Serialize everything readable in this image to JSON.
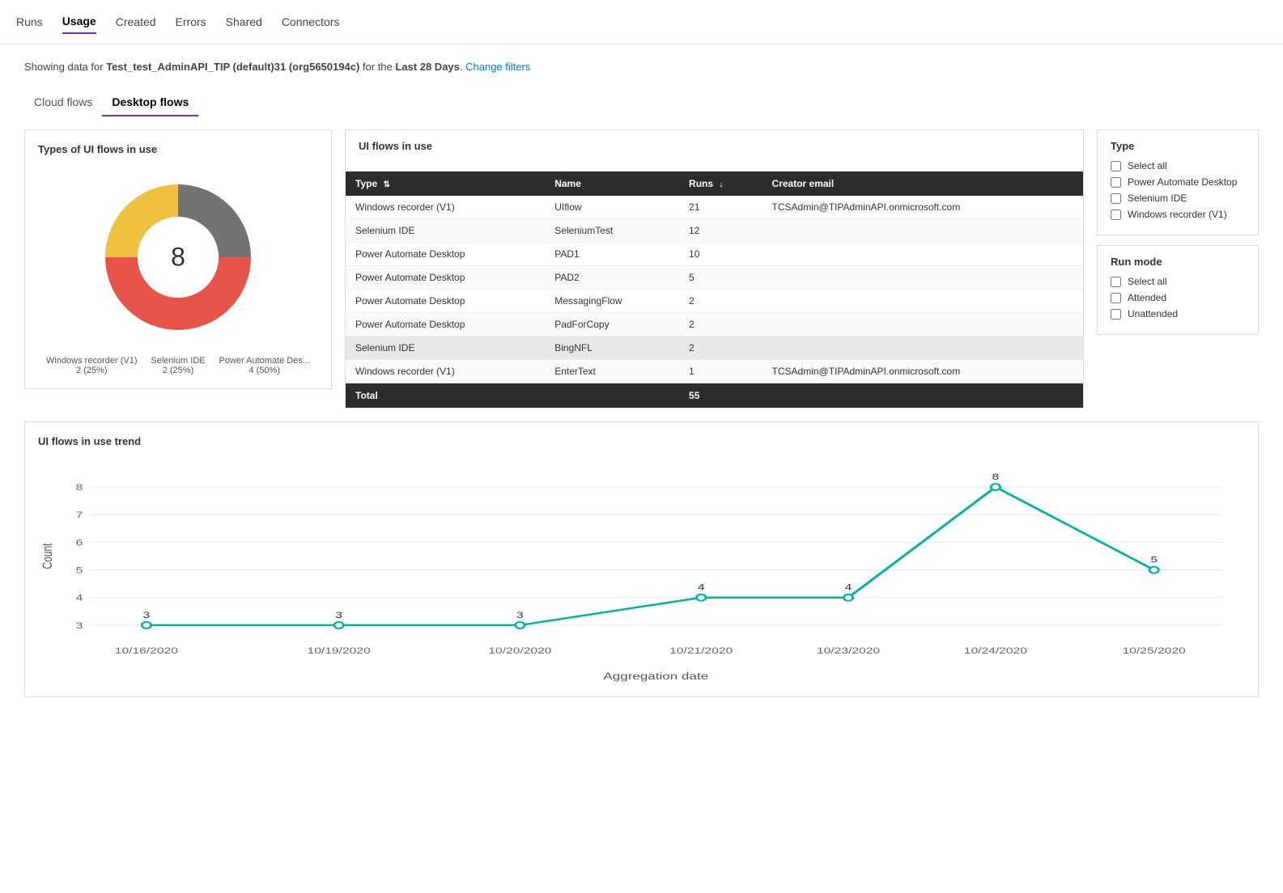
{
  "nav": {
    "items": [
      {
        "label": "Runs",
        "active": false
      },
      {
        "label": "Usage",
        "active": true
      },
      {
        "label": "Created",
        "active": false
      },
      {
        "label": "Errors",
        "active": false
      },
      {
        "label": "Shared",
        "active": false
      },
      {
        "label": "Connectors",
        "active": false
      }
    ]
  },
  "subtitle": {
    "prefix": "Showing data for",
    "org": "Test_test_AdminAPI_TIP (default)31 (org5650194c)",
    "mid": "for the",
    "period": "Last 28 Days",
    "link": "Change filters"
  },
  "flow_tabs": [
    {
      "label": "Cloud flows",
      "active": false
    },
    {
      "label": "Desktop flows",
      "active": true
    }
  ],
  "donut": {
    "title": "Types of UI flows in use",
    "center_value": "8",
    "segments": [
      {
        "label": "Windows recorder (V1)",
        "short": "Windows recorder (V1)",
        "value": "2 (25%)",
        "color": "#737373",
        "percent": 25
      },
      {
        "label": "Power Automate Des...",
        "short": "Power Automate Des...",
        "value": "4 (50%)",
        "color": "#e8534a",
        "percent": 50
      },
      {
        "label": "Selenium IDE",
        "short": "Selenium IDE",
        "value": "2 (25%)",
        "color": "#f0c040",
        "percent": 25
      }
    ]
  },
  "table": {
    "title": "UI flows in use",
    "columns": [
      "Type",
      "Name",
      "Runs",
      "Creator email"
    ],
    "rows": [
      {
        "type": "Windows recorder (V1)",
        "name": "UIflow",
        "runs": "21",
        "email": "TCSAdmin@TIPAdminAPI.onmicrosoft.com",
        "highlighted": false
      },
      {
        "type": "Selenium IDE",
        "name": "SeleniumTest",
        "runs": "12",
        "email": "",
        "highlighted": false
      },
      {
        "type": "Power Automate Desktop",
        "name": "PAD1",
        "runs": "10",
        "email": "",
        "highlighted": false
      },
      {
        "type": "Power Automate Desktop",
        "name": "PAD2",
        "runs": "5",
        "email": "",
        "highlighted": false
      },
      {
        "type": "Power Automate Desktop",
        "name": "MessagingFlow",
        "runs": "2",
        "email": "",
        "highlighted": false
      },
      {
        "type": "Power Automate Desktop",
        "name": "PadForCopy",
        "runs": "2",
        "email": "",
        "highlighted": false
      },
      {
        "type": "Selenium IDE",
        "name": "BingNFL",
        "runs": "2",
        "email": "",
        "highlighted": true
      },
      {
        "type": "Windows recorder (V1)",
        "name": "EnterText",
        "runs": "1",
        "email": "TCSAdmin@TIPAdminAPI.onmicrosoft.com",
        "highlighted": false
      }
    ],
    "footer_label": "Total",
    "footer_value": "55"
  },
  "type_filter": {
    "title": "Type",
    "options": [
      {
        "label": "Select all",
        "checked": false
      },
      {
        "label": "Power Automate Desktop",
        "checked": false
      },
      {
        "label": "Selenium IDE",
        "checked": false
      },
      {
        "label": "Windows recorder (V1)",
        "checked": false
      }
    ]
  },
  "run_mode_filter": {
    "title": "Run mode",
    "options": [
      {
        "label": "Select all",
        "checked": false
      },
      {
        "label": "Attended",
        "checked": false
      },
      {
        "label": "Unattended",
        "checked": false
      }
    ]
  },
  "trend": {
    "title": "UI flows in use trend",
    "x_axis_label": "Aggregation date",
    "y_axis_label": "Count",
    "y_max": 8,
    "y_min": 3,
    "y_ticks": [
      3,
      4,
      5,
      6,
      7,
      8
    ],
    "data_points": [
      {
        "date": "10/16/2020",
        "value": 3,
        "x_pct": 5
      },
      {
        "date": "10/19/2020",
        "value": 3,
        "x_pct": 22
      },
      {
        "date": "10/20/2020",
        "value": 3,
        "x_pct": 38
      },
      {
        "date": "10/21/2020",
        "value": 4,
        "x_pct": 54
      },
      {
        "date": "10/23/2020",
        "value": 4,
        "x_pct": 67
      },
      {
        "date": "10/24/2020",
        "value": 8,
        "x_pct": 80
      },
      {
        "date": "10/25/2020",
        "value": 5,
        "x_pct": 94
      }
    ]
  }
}
